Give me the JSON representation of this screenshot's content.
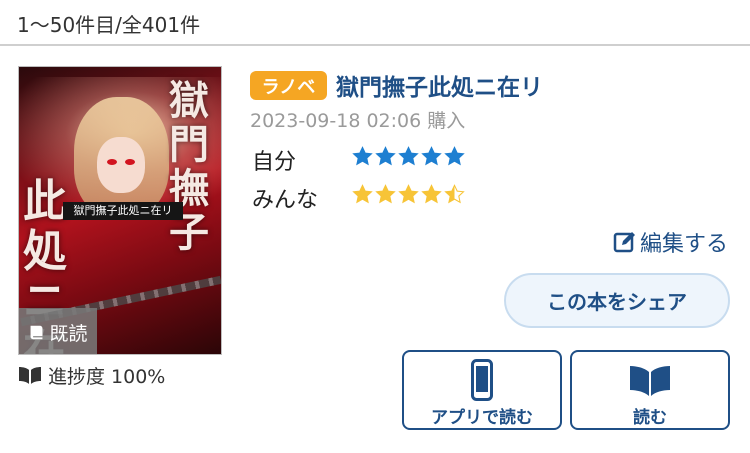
{
  "list_header": {
    "count_text": "1〜50件目/全401件"
  },
  "book": {
    "cover_title_band": "獄門撫子此処ニ在リ",
    "read_badge": "既読",
    "progress_text": "進捗度 100%",
    "label": "ラノベ",
    "title": "獄門撫子此処ニ在リ",
    "purchase_date": "2023-09-18 02:06 購入",
    "ratings": [
      {
        "label": "自分",
        "stars": 5,
        "color": "#1e7fd1"
      },
      {
        "label": "みんな",
        "stars": 4.5,
        "color": "#f7c437"
      }
    ]
  },
  "actions": {
    "edit_label": "編集する",
    "share_label": "この本をシェア",
    "app_read_label": "アプリで読む",
    "read_label": "読む"
  },
  "colors": {
    "accent": "#1f4f86",
    "badge": "#f5a623",
    "date": "#9a9a9a"
  }
}
